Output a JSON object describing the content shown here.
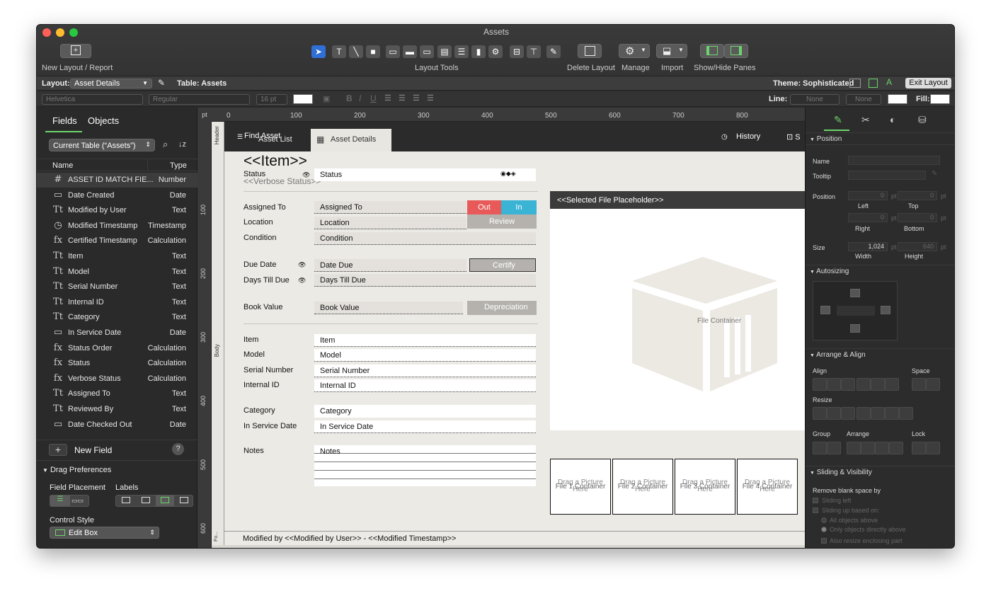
{
  "window": {
    "title": "Assets"
  },
  "toolbar": {
    "new_layout_label": "New Layout / Report",
    "layout_tools_label": "Layout Tools",
    "delete_layout_label": "Delete Layout",
    "manage_label": "Manage",
    "import_label": "Import",
    "show_hide_label": "Show/Hide Panes"
  },
  "layoutbar": {
    "layout_label": "Layout:",
    "layout_value": "Asset Details",
    "table_label": "Table: Assets",
    "theme_label": "Theme: Sophisticated",
    "exit_label": "Exit Layout"
  },
  "formatbar": {
    "font": "Helvetica",
    "style": "Regular",
    "size": "16 pt",
    "line_label": "Line:",
    "line_value1": "None",
    "line_value2": "None",
    "fill_label": "Fill:"
  },
  "leftpane": {
    "tab_fields": "Fields",
    "tab_objects": "Objects",
    "table_select": "Current Table (“Assets”)",
    "col_name": "Name",
    "col_type": "Type",
    "fields": [
      {
        "icon": "#",
        "name": "ASSET ID MATCH FIE...",
        "type": "Number"
      },
      {
        "icon": "▭",
        "name": "Date Created",
        "type": "Date"
      },
      {
        "icon": "Tt",
        "name": "Modified by User",
        "type": "Text"
      },
      {
        "icon": "◷",
        "name": "Modified Timestamp",
        "type": "Timestamp"
      },
      {
        "icon": "fx",
        "name": "Certified Timestamp",
        "type": "Calculation"
      },
      {
        "icon": "Tt",
        "name": "Item",
        "type": "Text"
      },
      {
        "icon": "Tt",
        "name": "Model",
        "type": "Text"
      },
      {
        "icon": "Tt",
        "name": "Serial Number",
        "type": "Text"
      },
      {
        "icon": "Tt",
        "name": "Internal ID",
        "type": "Text"
      },
      {
        "icon": "Tt",
        "name": "Category",
        "type": "Text"
      },
      {
        "icon": "▭",
        "name": "In Service Date",
        "type": "Date"
      },
      {
        "icon": "fx",
        "name": "Status Order",
        "type": "Calculation"
      },
      {
        "icon": "fx",
        "name": "Status",
        "type": "Calculation"
      },
      {
        "icon": "fx",
        "name": "Verbose Status",
        "type": "Calculation"
      },
      {
        "icon": "Tt",
        "name": "Assigned To",
        "type": "Text"
      },
      {
        "icon": "Tt",
        "name": "Reviewed By",
        "type": "Text"
      },
      {
        "icon": "▭",
        "name": "Date Checked Out",
        "type": "Date"
      }
    ],
    "new_field": "New Field",
    "help": "?",
    "drag_prefs": "Drag Preferences",
    "field_placement": "Field Placement",
    "labels": "Labels",
    "control_style": "Control Style",
    "control_value": "Edit Box"
  },
  "ruler": {
    "unit": "pt",
    "marks": [
      "0",
      "100",
      "200",
      "300",
      "400",
      "500",
      "600",
      "700",
      "800"
    ],
    "vmarks": [
      "100",
      "200",
      "300",
      "400",
      "500",
      "600"
    ]
  },
  "canvas": {
    "part_header": "Header",
    "part_body": "Body",
    "part_footer": "Fo...",
    "tab_find": "Find Asset",
    "tab_list": "Asset List",
    "tab_details": "Asset Details",
    "history": "History",
    "title": "<<Item>>",
    "verbose": "<<Verbose Status>>",
    "status_label": "Status",
    "status_field": "Status",
    "assigned_label": "Assigned To",
    "assigned_field": "Assigned To",
    "location_label": "Location",
    "location_field": "Location",
    "condition_label": "Condition",
    "condition_field": "Condition",
    "btn_out": "Out",
    "btn_in": "In",
    "btn_review": "Review",
    "due_label": "Due Date",
    "due_field": "Date Due",
    "days_label": "Days Till Due",
    "days_field": "Days Till Due",
    "certify": "Certify",
    "book_label": "Book Value",
    "book_field": "Book Value",
    "depreciation": "Depreciation",
    "item_label": "Item",
    "item_field": "Item",
    "model_label": "Model",
    "model_field": "Model",
    "serial_label": "Serial Number",
    "serial_field": "Serial Number",
    "internal_label": "Internal ID",
    "internal_field": "Internal ID",
    "category_label": "Category",
    "category_field": "Category",
    "inservice_label": "In Service Date",
    "inservice_field": "In Service Date",
    "notes_label": "Notes",
    "notes_field": "Notes",
    "selected_file": "<<Selected File Placeholder>>",
    "file_container": "File Container",
    "thumbs": [
      {
        "label": "File 1 Container",
        "drag": "Drag a Picture Here"
      },
      {
        "label": "File 2 Container",
        "drag": "Drag a Picture Here"
      },
      {
        "label": "File 3 Container",
        "drag": "Drag a Picture Here"
      },
      {
        "label": "File 4 Container",
        "drag": "Drag a Picture Here"
      }
    ],
    "footer": "Modified by <<Modified by User>> - <<Modified Timestamp>>"
  },
  "inspector": {
    "position_section": "Position",
    "name_label": "Name",
    "tooltip_label": "Tooltip",
    "position_label": "Position",
    "left_val": "0",
    "top_val": "0",
    "right_val": "0",
    "bottom_val": "0",
    "unit": "pt",
    "left_lbl": "Left",
    "top_lbl": "Top",
    "right_lbl": "Right",
    "bottom_lbl": "Bottom",
    "size_label": "Size",
    "width_val": "1,024",
    "height_val": "640",
    "width_lbl": "Width",
    "height_lbl": "Height",
    "autosizing": "Autosizing",
    "arrange_align": "Arrange & Align",
    "align": "Align",
    "space": "Space",
    "resize": "Resize",
    "group": "Group",
    "arrange": "Arrange",
    "lock": "Lock",
    "sliding": "Sliding & Visibility",
    "remove_blank": "Remove blank space by",
    "sliding_left": "Sliding left",
    "sliding_up": "Sliding up based on:",
    "all_above": "All objects above",
    "only_directly": "Only objects directly above",
    "also_resize": "Also resize enclosing part"
  }
}
